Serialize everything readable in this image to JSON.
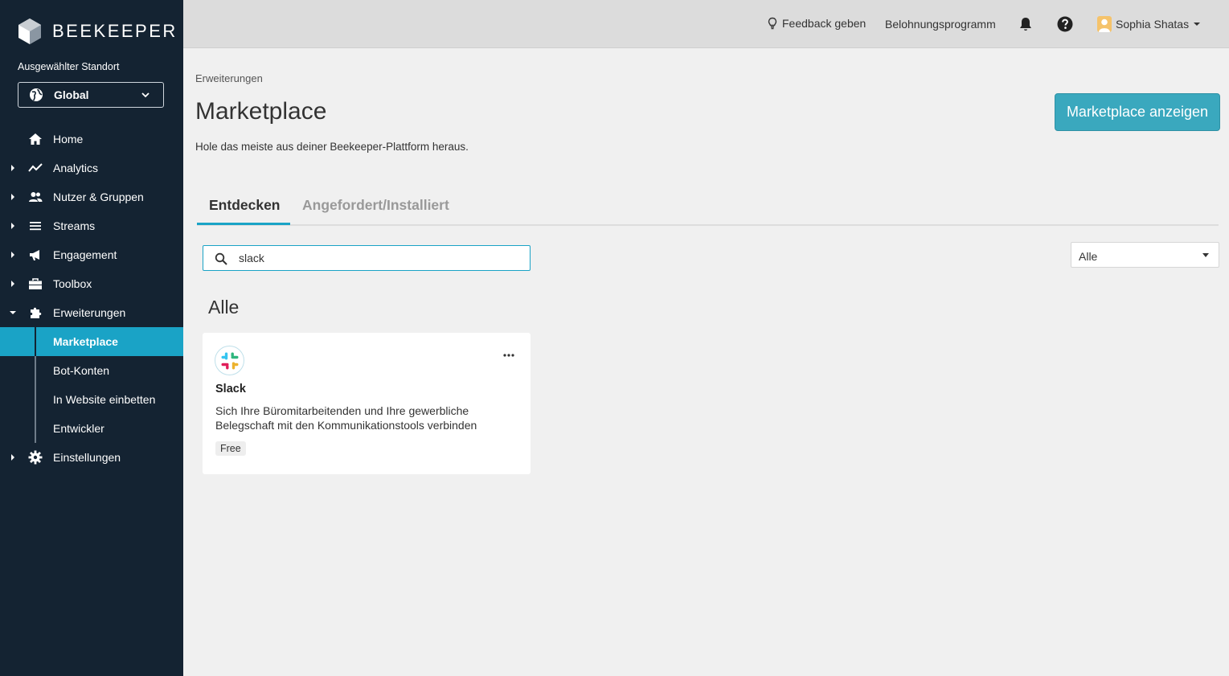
{
  "brand": {
    "name": "BEEKEEPER"
  },
  "location": {
    "label": "Ausgewählter Standort",
    "value": "Global"
  },
  "nav": {
    "home": "Home",
    "analytics": "Analytics",
    "users": "Nutzer & Gruppen",
    "streams": "Streams",
    "engagement": "Engagement",
    "toolbox": "Toolbox",
    "extensions": "Erweiterungen",
    "sub": {
      "marketplace": "Marketplace",
      "bots": "Bot-Konten",
      "embed": "In Website einbetten",
      "developer": "Entwickler"
    },
    "settings": "Einstellungen"
  },
  "topbar": {
    "feedback": "Feedback geben",
    "rewards": "Belohnungsprogramm",
    "user": "Sophia Shatas"
  },
  "page": {
    "breadcrumb": "Erweiterungen",
    "title": "Marketplace",
    "subtitle": "Hole das meiste aus deiner Beekeeper-Plattform heraus.",
    "cta": "Marketplace anzeigen"
  },
  "tabs": {
    "discover": "Entdecken",
    "installed": "Angefordert/Installiert"
  },
  "search": {
    "value": "slack"
  },
  "filter": {
    "value": "Alle"
  },
  "section": {
    "title": "Alle"
  },
  "card": {
    "name": "Slack",
    "description": "Sich Ihre Büromitarbeitenden und Ihre gewerbliche Belegschaft mit den Kommunikationstools verbinden",
    "badge": "Free"
  },
  "colors": {
    "sidebar": "#142332",
    "accent": "#1aa3c6",
    "cta": "#3aa8be"
  }
}
